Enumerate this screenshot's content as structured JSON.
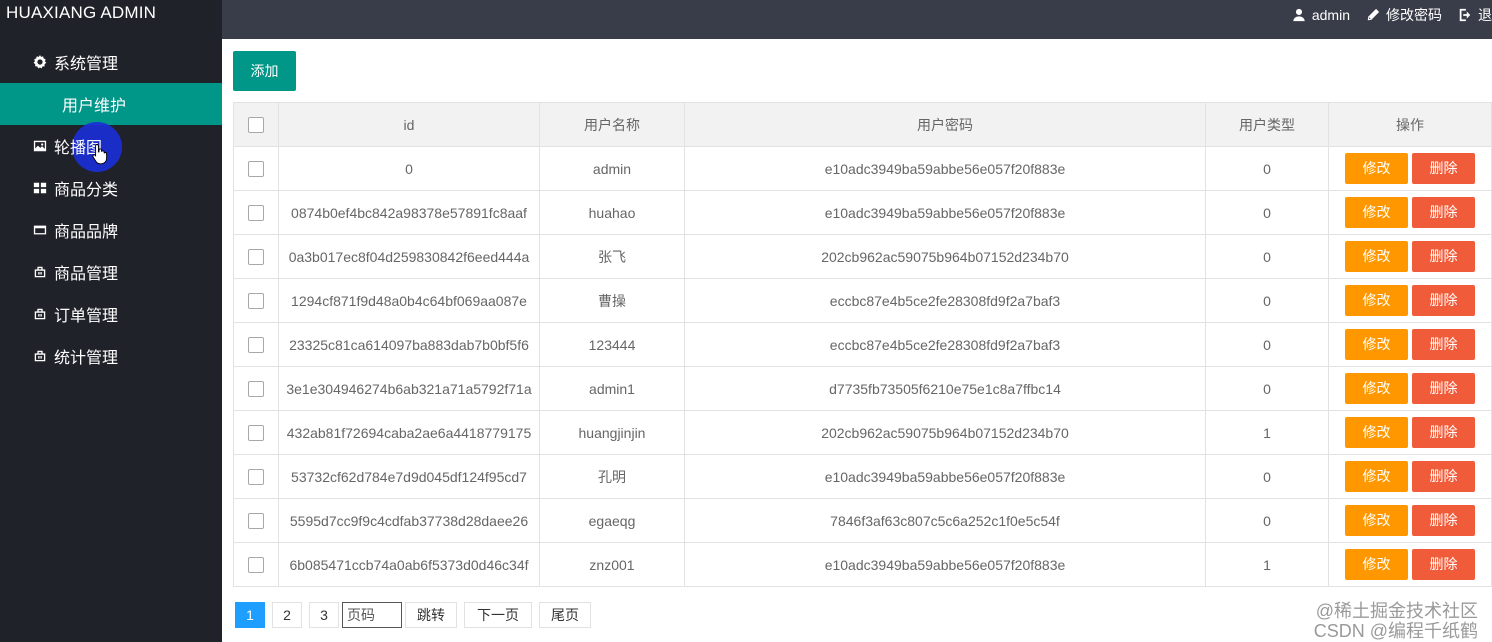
{
  "brand": "HUAXIANG ADMIN",
  "sidebar": {
    "items": [
      {
        "label": "系统管理",
        "icon": "gear-icon"
      },
      {
        "label": "用户维护",
        "icon": ""
      },
      {
        "label": "轮播图",
        "icon": "image-icon"
      },
      {
        "label": "商品分类",
        "icon": "grid-icon"
      },
      {
        "label": "商品品牌",
        "icon": "card-icon"
      },
      {
        "label": "商品管理",
        "icon": "bag-icon"
      },
      {
        "label": "订单管理",
        "icon": "bag-icon"
      },
      {
        "label": "统计管理",
        "icon": "bag-icon"
      }
    ]
  },
  "header": {
    "user": "admin",
    "change_password": "修改密码",
    "logout": "退"
  },
  "toolbar": {
    "add_label": "添加"
  },
  "table": {
    "columns": [
      "id",
      "用户名称",
      "用户密码",
      "用户类型",
      "操作"
    ],
    "edit_label": "修改",
    "delete_label": "删除",
    "rows": [
      {
        "id": "0",
        "name": "admin",
        "password": "e10adc3949ba59abbe56e057f20f883e",
        "type": "0"
      },
      {
        "id": "0874b0ef4bc842a98378e57891fc8aaf",
        "name": "huahao",
        "password": "e10adc3949ba59abbe56e057f20f883e",
        "type": "0"
      },
      {
        "id": "0a3b017ec8f04d259830842f6eed444a",
        "name": "张飞",
        "password": "202cb962ac59075b964b07152d234b70",
        "type": "0"
      },
      {
        "id": "1294cf871f9d48a0b4c64bf069aa087e",
        "name": "曹操",
        "password": "eccbc87e4b5ce2fe28308fd9f2a7baf3",
        "type": "0"
      },
      {
        "id": "23325c81ca614097ba883dab7b0bf5f6",
        "name": "123444",
        "password": "eccbc87e4b5ce2fe28308fd9f2a7baf3",
        "type": "0"
      },
      {
        "id": "3e1e304946274b6ab321a71a5792f71a",
        "name": "admin1",
        "password": "d7735fb73505f6210e75e1c8a7ffbc14",
        "type": "0"
      },
      {
        "id": "432ab81f72694caba2ae6a4418779175",
        "name": "huangjinjin",
        "password": "202cb962ac59075b964b07152d234b70",
        "type": "1"
      },
      {
        "id": "53732cf62d784e7d9d045df124f95cd7",
        "name": "孔明",
        "password": "e10adc3949ba59abbe56e057f20f883e",
        "type": "0"
      },
      {
        "id": "5595d7cc9f9c4cdfab37738d28daee26",
        "name": "egaeqg",
        "password": "7846f3af63c807c5c6a252c1f0e5c54f",
        "type": "0"
      },
      {
        "id": "6b085471ccb74a0ab6f5373d0d46c34f",
        "name": "znz001",
        "password": "e10adc3949ba59abbe56e057f20f883e",
        "type": "1"
      }
    ]
  },
  "pagination": {
    "pages": [
      "1",
      "2",
      "3"
    ],
    "current": "1",
    "input_placeholder": "页码",
    "jump_label": "跳转",
    "next_label": "下一页",
    "last_label": "尾页"
  },
  "watermark": {
    "line1": "@稀土掘金技术社区",
    "line2": "CSDN @编程千纸鹤"
  },
  "colors": {
    "sidebar": "#20222a",
    "header": "#393d49",
    "accent": "#009688",
    "edit": "#ff9800",
    "delete": "#f05c3a",
    "page_active": "#1e9fff"
  }
}
